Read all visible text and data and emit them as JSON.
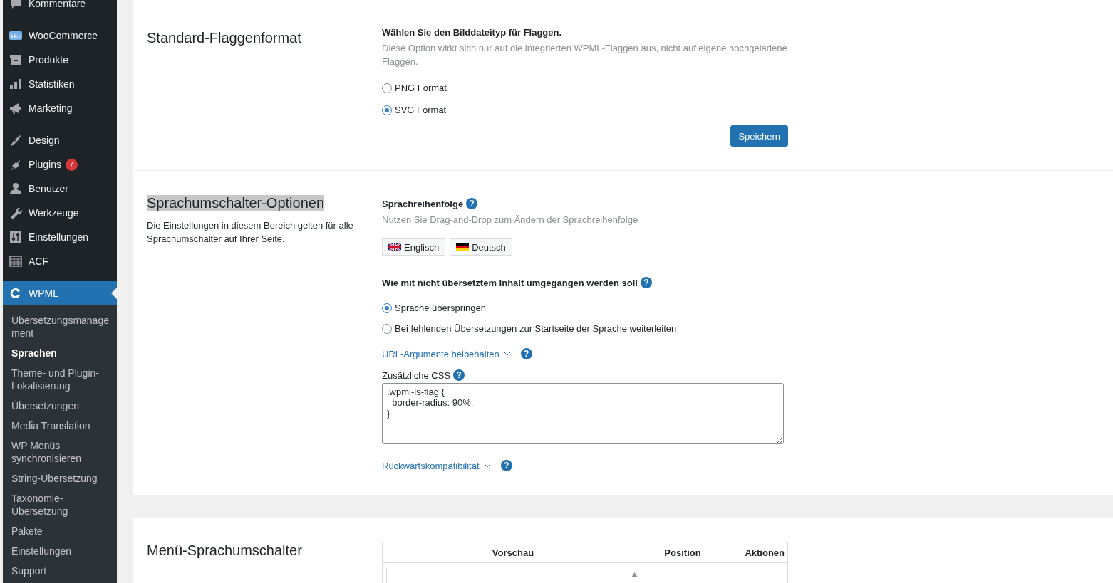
{
  "sidebar": {
    "menu_groups": [
      [
        {
          "label": "Kommentare",
          "current": false
        }
      ],
      [
        {
          "label": "WooCommerce",
          "current": false
        },
        {
          "label": "Produkte",
          "current": false
        },
        {
          "label": "Statistiken",
          "current": false
        },
        {
          "label": "Marketing",
          "current": false
        }
      ],
      [
        {
          "label": "Design",
          "current": false
        },
        {
          "label": "Plugins",
          "badge": "7",
          "current": false
        },
        {
          "label": "Benutzer",
          "current": false
        },
        {
          "label": "Werkzeuge",
          "current": false
        },
        {
          "label": "Einstellungen",
          "current": false
        },
        {
          "label": "ACF",
          "current": false
        }
      ],
      [
        {
          "label": "WPML",
          "current": true
        }
      ]
    ],
    "submenu": [
      {
        "label": "Übersetzungsmanagement",
        "selected": false
      },
      {
        "label": "Sprachen",
        "selected": true
      },
      {
        "label": "Theme- und Plugin-Lokalisierung",
        "selected": false
      },
      {
        "label": "Übersetzungen",
        "selected": false
      },
      {
        "label": "Media Translation",
        "selected": false
      },
      {
        "label": "WP Menüs synchronisieren",
        "selected": false
      },
      {
        "label": "String-Übersetzung",
        "selected": false
      },
      {
        "label": "Taxonomie-Übersetzung",
        "selected": false
      },
      {
        "label": "Pakete",
        "selected": false
      },
      {
        "label": "Einstellungen",
        "selected": false
      },
      {
        "label": "Support",
        "selected": false
      }
    ]
  },
  "flag_format": {
    "title": "Standard-Flaggenformat",
    "heading": "Wählen Sie den Bilddateityp für Flaggen.",
    "description": "Diese Option wirkt sich nur auf die integrierten WPML-Flaggen aus, nicht auf eigene hochgeladene Flaggen.",
    "options": [
      {
        "label": "PNG Format",
        "selected": false
      },
      {
        "label": "SVG Format",
        "selected": true
      }
    ],
    "save_button": "Speichern"
  },
  "switcher_options": {
    "title": "Sprachumschalter-Optionen",
    "title_highlighted": true,
    "description": "Die Einstellungen in diesem Bereich gelten für alle Sprachumschalter auf Ihrer Seite.",
    "order_heading": "Sprachreihenfolge",
    "order_help": "?",
    "untranslated_help": "?",
    "url_args_help": "?",
    "css_help": "?",
    "compat_help": "?",
    "order_hint": "Nutzen Sie Drag-and-Drop zum Ändern der Sprachreihenfolge",
    "languages": [
      {
        "label": "Englisch"
      },
      {
        "label": "Deutsch"
      }
    ],
    "untranslated_heading": "Wie mit nicht übersetztem Inhalt umgegangen werden soll",
    "untranslated_options": [
      {
        "label": "Sprache überspringen",
        "selected": true
      },
      {
        "label": "Bei fehlenden Übersetzungen zur Startseite der Sprache weiterleiten",
        "selected": false
      }
    ],
    "url_args_link": "URL-Argumente beibehalten",
    "css_label": "Zusätzliche CSS",
    "css_value": ".wpml-ls-flag {\n  border-radius: 90%;\n}",
    "compat_link": "Rückwärtskompatibilität"
  },
  "menu_switcher": {
    "title": "Menü-Sprachumschalter",
    "columns": [
      "Vorschau",
      "Position",
      "Aktionen"
    ]
  }
}
